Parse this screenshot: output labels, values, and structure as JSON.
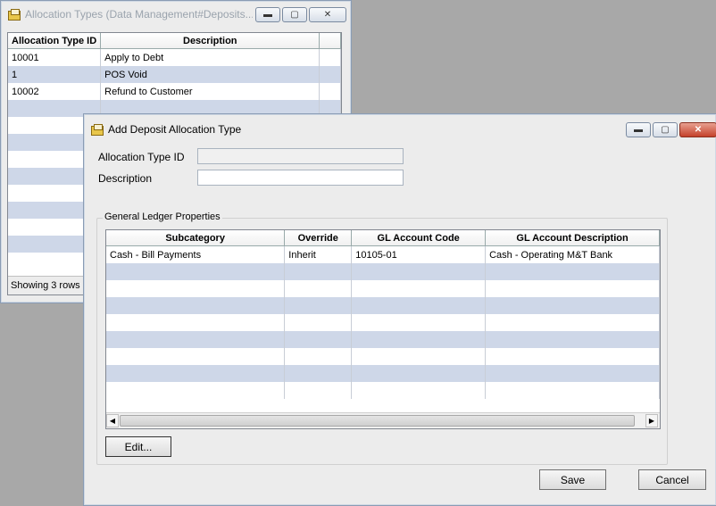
{
  "back_window": {
    "title": "Allocation Types (Data Management#Deposits...",
    "columns": [
      "Allocation Type ID",
      "Description"
    ],
    "rows": [
      [
        "10001",
        "Apply to Debt"
      ],
      [
        "1",
        "POS Void"
      ],
      [
        "10002",
        "Refund to Customer"
      ]
    ],
    "status": "Showing 3 rows"
  },
  "dialog": {
    "title": "Add Deposit Allocation Type",
    "fields": {
      "allocation_type_id_label": "Allocation Type ID",
      "allocation_type_id_value": "",
      "description_label": "Description",
      "description_value": ""
    },
    "group": {
      "legend": "General Ledger Properties",
      "columns": [
        "Subcategory",
        "Override",
        "GL Account Code",
        "GL Account Description"
      ],
      "rows": [
        [
          "Cash - Bill Payments",
          "Inherit",
          "10105-01",
          "Cash - Operating M&T Bank"
        ]
      ],
      "edit_label": "Edit..."
    },
    "save_label": "Save",
    "cancel_label": "Cancel"
  },
  "icons": {
    "window": "folder-icon",
    "minimize": "minimize-icon",
    "maximize": "maximize-icon",
    "close": "close-icon",
    "scroll_left": "arrow-left-icon",
    "scroll_right": "arrow-right-icon"
  }
}
